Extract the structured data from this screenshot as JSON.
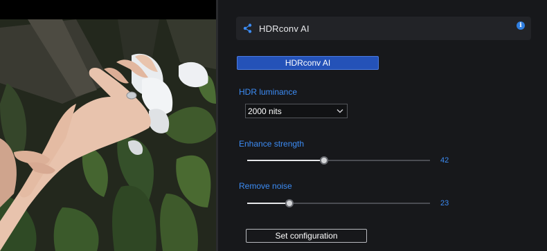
{
  "preview": {
    "description_icon": "video-frame"
  },
  "panel": {
    "header": {
      "icon": "share-icon",
      "title": "HDRconv AI",
      "info_icon": "info-icon"
    },
    "mode_button": {
      "label": "HDRconv AI"
    },
    "hdr_luminance": {
      "label": "HDR luminance",
      "selected": "2000 nits",
      "icon": "chevron-down-icon"
    },
    "enhance_strength": {
      "label": "Enhance strength",
      "value": "42",
      "fraction": 0.42
    },
    "remove_noise": {
      "label": "Remove noise",
      "value": "23",
      "fraction": 0.23
    },
    "set_button": {
      "label": "Set configuration"
    }
  },
  "colors": {
    "accent": "#3c8cf5",
    "button": "#2452b8",
    "panel_bg": "#17181b",
    "header_bg": "#222327"
  }
}
